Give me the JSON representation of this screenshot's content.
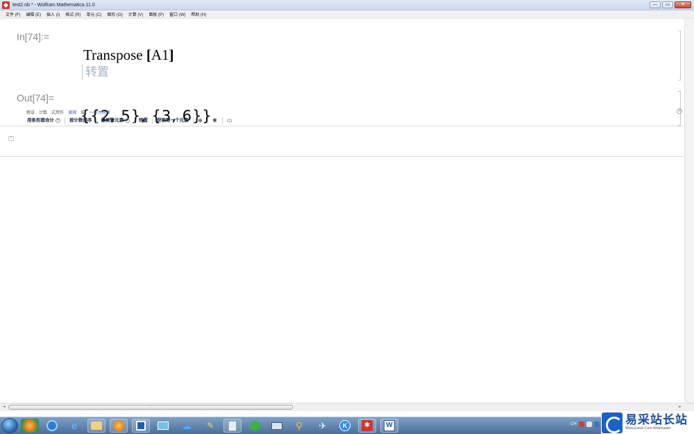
{
  "window": {
    "title": "test2.nb * - Wolfram Mathematica 11.0",
    "minimize": "—",
    "maximize": "▭",
    "close": "✕"
  },
  "menu": [
    "文件 (F)",
    "编辑 (E)",
    "插入 (I)",
    "格式 (R)",
    "单元 (C)",
    "图形 (G)",
    "计算 (V)",
    "面板 (P)",
    "窗口 (W)",
    "帮助 (H)"
  ],
  "notebook": {
    "in_label": "In[74]:=",
    "input_func": "Transpose",
    "input_open": "[",
    "input_arg": "A1",
    "input_close": "]",
    "hint": "转置",
    "out_label": "Out[74]=",
    "output": "{{2, 5}, {3, 6}}"
  },
  "suggestions": {
    "row1": [
      "假设",
      "计数",
      "式用作",
      "矩阵",
      "或",
      "一般方向表"
    ],
    "row1_italic": [
      false,
      false,
      false,
      true,
      false,
      true
    ],
    "row2": [
      "用条形图合计",
      "按计数排序",
      "最频繁元素",
      "转置",
      "获取第一个元素"
    ]
  },
  "taskbar": {
    "tray": [
      "CH"
    ],
    "watermark_cn": "易采站长站",
    "watermark_en": "Www.Easck.Com Webmaster"
  },
  "colors": {
    "label_gray": "#8a8a8a",
    "hint_color": "#a5b3c4",
    "taskbar": "#4b6f99"
  }
}
